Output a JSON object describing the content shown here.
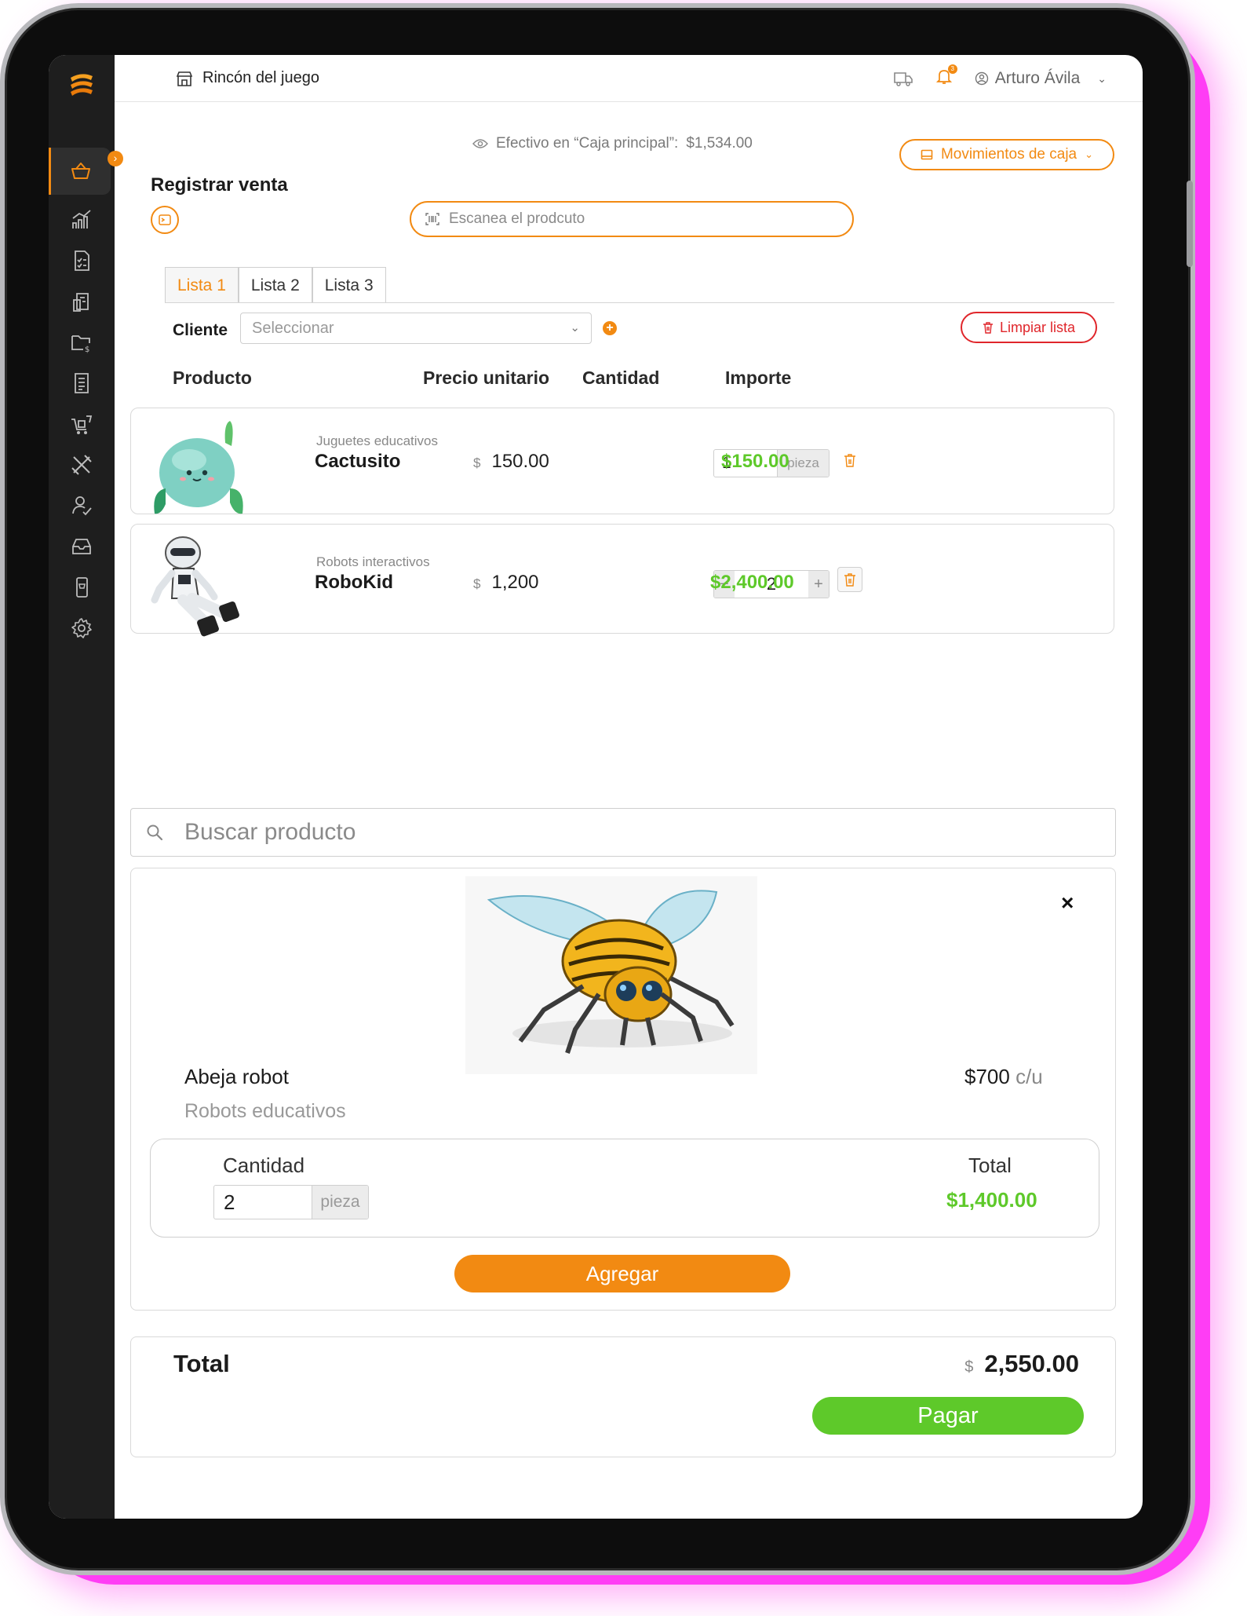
{
  "header": {
    "store_name": "Rincón del juego",
    "user_name": "Arturo Ávila",
    "notification_count": "3"
  },
  "cash": {
    "label": "Efectivo en “Caja principal”:",
    "amount": "$1,534.00"
  },
  "movements_button": "Movimientos de caja",
  "page_title": "Registrar venta",
  "scan_placeholder": "Escanea el prodcuto",
  "tabs": [
    "Lista 1",
    "Lista 2",
    "Lista 3"
  ],
  "active_tab": "Lista 1",
  "client": {
    "label": "Cliente",
    "placeholder": "Seleccionar"
  },
  "clear_button": "Limpiar lista",
  "columns": {
    "product": "Producto",
    "unit_price": "Precio unitario",
    "quantity": "Cantidad",
    "amount": "Importe"
  },
  "cart_items": [
    {
      "category": "Juguetes educativos",
      "name": "Cactusito",
      "currency": "$",
      "price": "150.00",
      "quantity": "1",
      "unit": "pieza",
      "amount": "$150.00"
    },
    {
      "category": "Robots interactivos",
      "name": "RoboKid",
      "currency": "$",
      "price": "1,200",
      "quantity": "2",
      "minus": "−",
      "plus": "+",
      "amount": "$2,400.00"
    }
  ],
  "search_placeholder": "Buscar producto",
  "detail": {
    "name": "Abeja robot",
    "category": "Robots educativos",
    "price": "$700",
    "per_unit": "c/u",
    "quantity_label": "Cantidad",
    "quantity": "2",
    "unit": "pieza",
    "total_label": "Total",
    "total": "$1,400.00",
    "add_button": "Agregar",
    "close": "×"
  },
  "summary": {
    "label": "Total",
    "currency": "$",
    "value": "2,550.00",
    "pay_button": "Pagar"
  },
  "colors": {
    "accent": "#f28a12",
    "success": "#5ec92a",
    "danger": "#e0262b",
    "sidebar": "#1e1e1e"
  },
  "sidebar_icons": [
    "basket-icon",
    "chart-icon",
    "report-icon",
    "inventory-icon",
    "folder-money-icon",
    "ledger-icon",
    "cart-icon",
    "tools-icon",
    "user-check-icon",
    "inbox-icon",
    "mobile-icon",
    "gear-icon"
  ]
}
